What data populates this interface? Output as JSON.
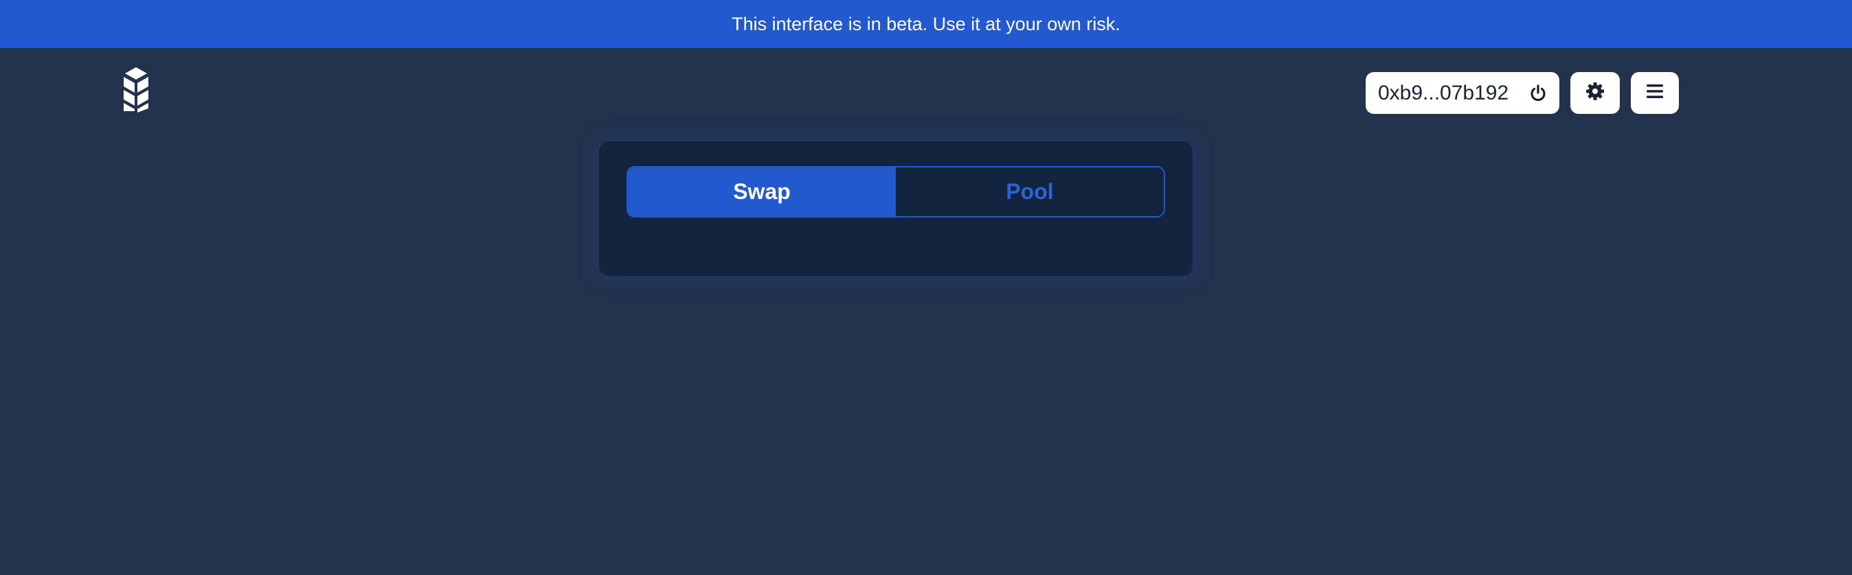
{
  "banner": {
    "text": "This interface is in beta. Use it at your own risk."
  },
  "header": {
    "logo_icon": "wheat-logo-icon",
    "wallet": {
      "address": "0xb9...07b192",
      "icon": "power-icon"
    },
    "settings_icon": "gear-icon",
    "menu_icon": "hamburger-menu-icon"
  },
  "main": {
    "tabs": [
      {
        "label": "Swap",
        "active": true
      },
      {
        "label": "Pool",
        "active": false
      }
    ]
  },
  "colors": {
    "background": "#22324c",
    "banner": "#2259cf",
    "panel": "#12243f",
    "accent": "#2259cf",
    "inactive_tab_text": "#2c63d6"
  }
}
